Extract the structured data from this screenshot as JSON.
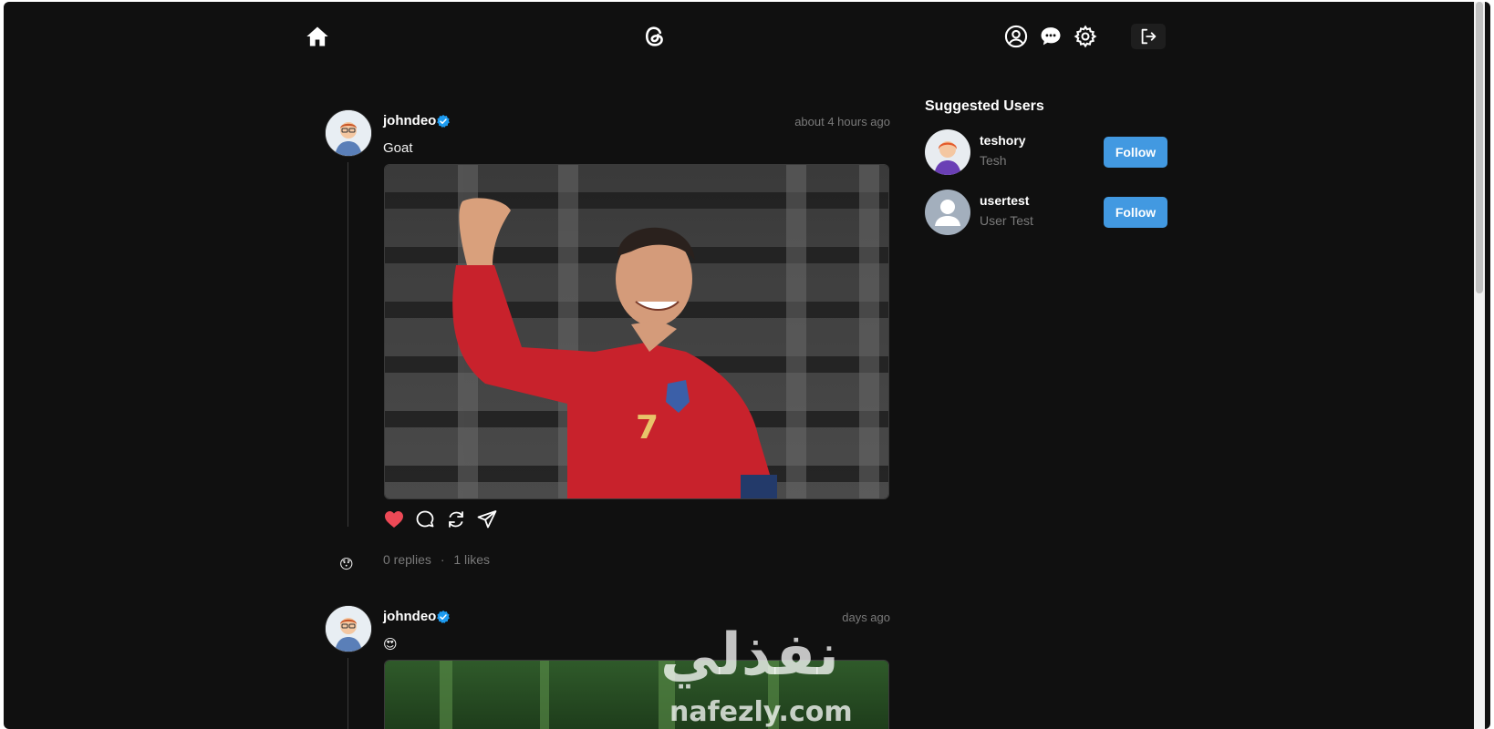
{
  "header": {
    "home_icon": "home-icon",
    "logo_icon": "threads-logo-icon",
    "profile_icon": "user-circle-icon",
    "chat_icon": "chat-bubbles-icon",
    "settings_icon": "gear-icon",
    "logout_icon": "logout-icon"
  },
  "posts": [
    {
      "username": "johndeo",
      "verified": true,
      "timestamp": "about 4 hours ago",
      "text": "Goat",
      "liked": true,
      "replies": "0 replies",
      "separator": "·",
      "likes": "1 likes",
      "reply_emoji": "😯"
    },
    {
      "username": "johndeo",
      "verified": true,
      "timestamp": "days ago",
      "text": "😍"
    }
  ],
  "suggested": {
    "title": "Suggested Users",
    "users": [
      {
        "username": "teshory",
        "name": "Tesh",
        "button": "Follow"
      },
      {
        "username": "usertest",
        "name": "User Test",
        "button": "Follow"
      }
    ]
  },
  "watermark": {
    "arabic": "نفذلي",
    "latin": "nafezly.com"
  },
  "colors": {
    "background": "#101010",
    "accent": "#4299e1",
    "verified": "#1d9bf0",
    "like": "#ed4956"
  }
}
